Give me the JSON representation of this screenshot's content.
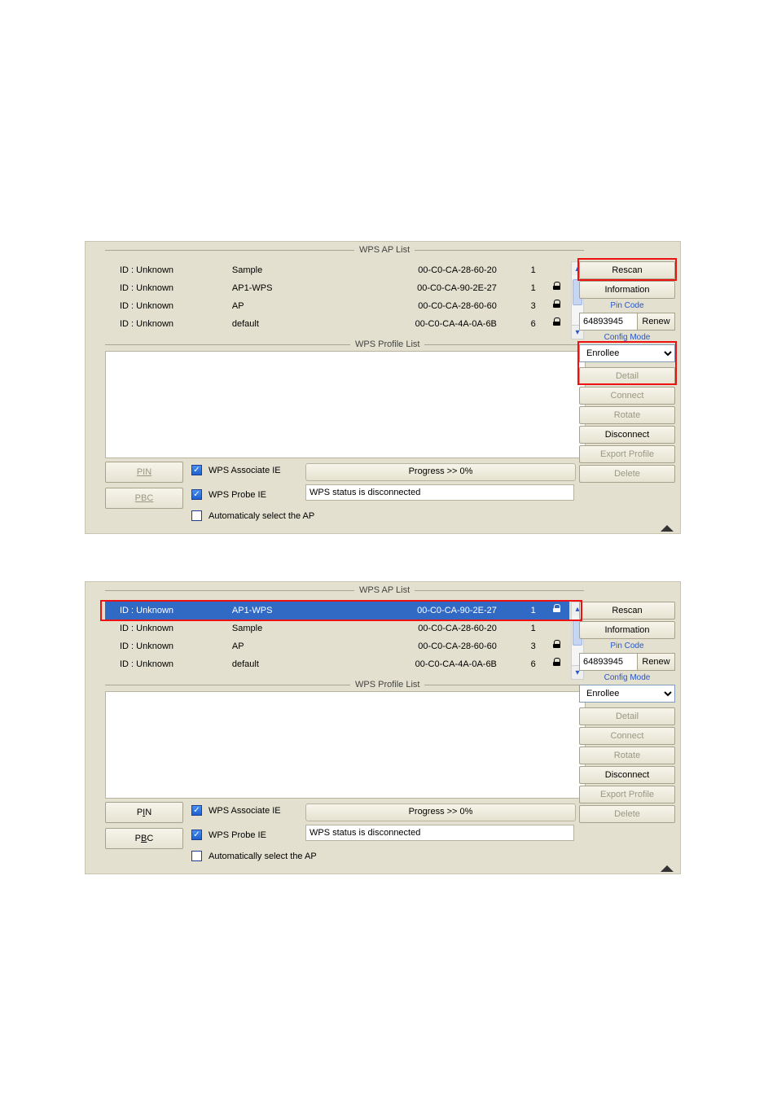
{
  "section_titles": {
    "ap": "WPS AP List",
    "profile": "WPS Profile List"
  },
  "panel1": {
    "rows": [
      {
        "id": "ID : Unknown",
        "ssid": "Sample",
        "mac": "00-C0-CA-28-60-20",
        "ch": "1",
        "lock": false,
        "sel": false
      },
      {
        "id": "ID : Unknown",
        "ssid": "AP1-WPS",
        "mac": "00-C0-CA-90-2E-27",
        "ch": "1",
        "lock": true,
        "sel": false
      },
      {
        "id": "ID : Unknown",
        "ssid": "AP",
        "mac": "00-C0-CA-28-60-60",
        "ch": "3",
        "lock": true,
        "sel": false
      },
      {
        "id": "ID : Unknown",
        "ssid": "default",
        "mac": "00-C0-CA-4A-0A-6B",
        "ch": "6",
        "lock": true,
        "sel": false
      }
    ],
    "pin_code": "64893945",
    "config_mode": "Enrollee",
    "progress": "Progress >> 0%",
    "status": "WPS status is disconnected",
    "chk": {
      "assoc": "WPS Associate IE",
      "probe": "WPS Probe IE",
      "auto": "Automaticaly select the AP"
    },
    "pin_enabled": false,
    "pbc_enabled": false
  },
  "panel2": {
    "rows": [
      {
        "id": "ID : Unknown",
        "ssid": "AP1-WPS",
        "mac": "00-C0-CA-90-2E-27",
        "ch": "1",
        "lock": true,
        "sel": true
      },
      {
        "id": "ID : Unknown",
        "ssid": "Sample",
        "mac": "00-C0-CA-28-60-20",
        "ch": "1",
        "lock": false,
        "sel": false
      },
      {
        "id": "ID : Unknown",
        "ssid": "AP",
        "mac": "00-C0-CA-28-60-60",
        "ch": "3",
        "lock": true,
        "sel": false
      },
      {
        "id": "ID : Unknown",
        "ssid": "default",
        "mac": "00-C0-CA-4A-0A-6B",
        "ch": "6",
        "lock": true,
        "sel": false
      }
    ],
    "pin_code": "64893945",
    "config_mode": "Enrollee",
    "progress": "Progress >> 0%",
    "status": "WPS status is disconnected",
    "chk": {
      "assoc": "WPS Associate IE",
      "probe": "WPS Probe IE",
      "auto": "Automatically select the AP"
    },
    "pin_enabled": true,
    "pbc_enabled": true
  },
  "btns": {
    "rescan": "Rescan",
    "information": "Information",
    "pincode": "Pin Code",
    "renew": "Renew",
    "configmode": "Config Mode",
    "detail": "Detail",
    "connect": "Connect",
    "rotate": "Rotate",
    "disconnect": "Disconnect",
    "export": "Export Profile",
    "delete": "Delete",
    "pin_pre": "P",
    "pin_u": "I",
    "pin_post": "N",
    "pbc_pre": "P",
    "pbc_u": "B",
    "pbc_post": "C"
  }
}
